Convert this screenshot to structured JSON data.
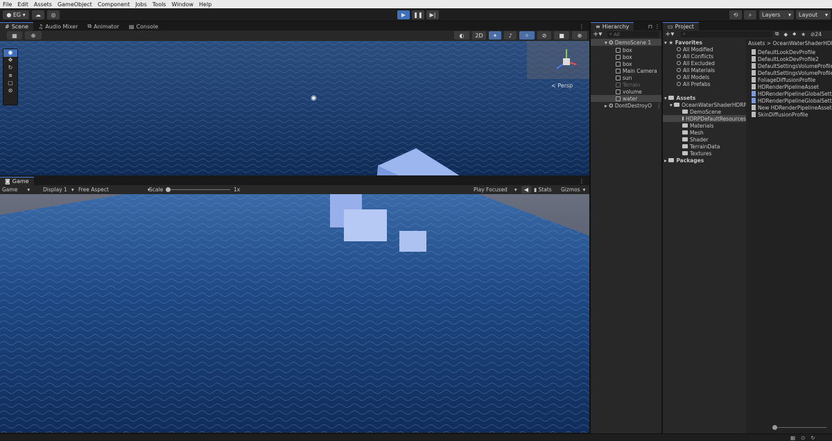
{
  "menu": [
    "File",
    "Edit",
    "Assets",
    "GameObject",
    "Component",
    "Jobs",
    "Tools",
    "Window",
    "Help"
  ],
  "toolbar": {
    "account": "EG",
    "layers": "Layers",
    "layout": "Layout"
  },
  "scene_tabs": [
    "Scene",
    "Audio Mixer",
    "Animator",
    "Console"
  ],
  "scene": {
    "mode_2d": "2D",
    "persp": "< Persp"
  },
  "game_tab": "Game",
  "game_bar": {
    "view": "Game",
    "display": "Display 1",
    "aspect": "Free Aspect",
    "scale_label": "Scale",
    "scale_value": "1x",
    "play_focused": "Play Focused",
    "stats": "Stats",
    "gizmos": "Gizmos"
  },
  "hierarchy": {
    "title": "Hierarchy",
    "search_placeholder": "All",
    "scene": "DemoScene 1",
    "items": [
      {
        "label": "box",
        "dim": false
      },
      {
        "label": "box",
        "dim": false
      },
      {
        "label": "box",
        "dim": false
      },
      {
        "label": "Main Camera",
        "dim": false
      },
      {
        "label": "sun",
        "dim": false
      },
      {
        "label": "Terrain",
        "dim": true
      },
      {
        "label": "volume",
        "dim": false
      },
      {
        "label": "water",
        "dim": false
      }
    ],
    "dont_destroy": "DontDestroyO"
  },
  "project": {
    "title": "Project",
    "count": "24",
    "favorites_label": "Favorites",
    "favorites": [
      "All Modified",
      "All Conflicts",
      "All Excluded",
      "All Materials",
      "All Models",
      "All Prefabs"
    ],
    "assets_label": "Assets",
    "root_folder": "OceanWaterShaderHDRP",
    "subfolders": [
      "DemoScene",
      "HDRPDefaultResources",
      "Materials",
      "Mesh",
      "Shader",
      "TerrainData",
      "Textures"
    ],
    "packages_label": "Packages",
    "breadcrumb": [
      "Assets",
      "OceanWaterShaderHDRP"
    ],
    "files": [
      "DefaultLookDevProfile",
      "DefaultLookDevProfile2",
      "DefaultSettingsVolumeProfile",
      "DefaultSettingsVolumeProfile",
      "FoliageDiffusionProfile",
      "HDRenderPipelineAsset",
      "HDRenderPipelineGlobalSett",
      "HDRenderPipelineGlobalSett",
      "New HDRenderPipelineAsset",
      "SkinDiffusionProfile"
    ]
  },
  "colors": {
    "accent": "#4a7ad8",
    "water_dark": "#0f2a55",
    "water_light": "#3a6aa8",
    "cube": "#8aa8e8"
  }
}
